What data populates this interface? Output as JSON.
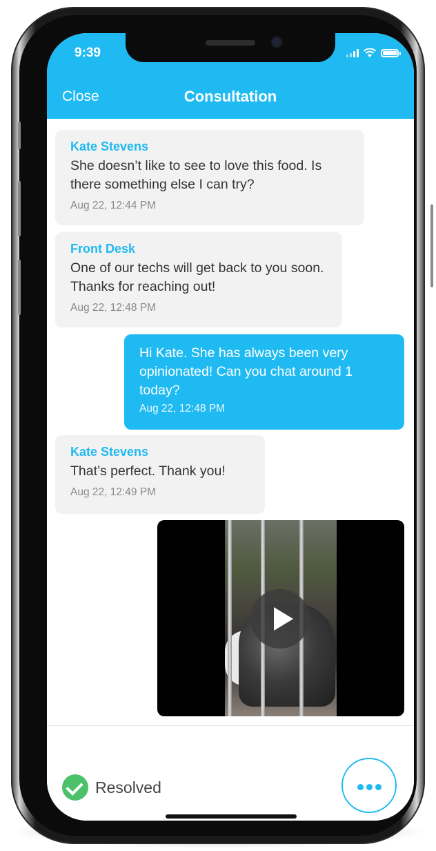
{
  "status_bar": {
    "time": "9:39"
  },
  "header": {
    "close_label": "Close",
    "title": "Consultation"
  },
  "messages": [
    {
      "direction": "in",
      "sender": "Kate Stevens",
      "text": "She doesn’t like to see to love this food. Is there something else I can try?",
      "time": "Aug 22, 12:44 PM"
    },
    {
      "direction": "in",
      "sender": "Front Desk",
      "text": "One of our techs will get back to you soon. Thanks for reaching out!",
      "time": "Aug 22, 12:48 PM"
    },
    {
      "direction": "out",
      "sender": "",
      "text": "Hi Kate. She has always been very opinionated! Can you chat around 1 today?",
      "time": "Aug 22, 12:48 PM"
    },
    {
      "direction": "in",
      "sender": "Kate Stevens",
      "text": "That’s perfect. Thank you!",
      "time": "Aug 22, 12:49 PM"
    },
    {
      "direction": "out",
      "type": "video",
      "icon": "play-icon"
    }
  ],
  "footer": {
    "status_label": "Resolved",
    "status_icon": "check-circle-icon",
    "more_icon": "more-horizontal-icon"
  },
  "colors": {
    "accent": "#1fbaf2",
    "incoming_bubble": "#f2f2f2",
    "resolved_green": "#4cc16a"
  }
}
